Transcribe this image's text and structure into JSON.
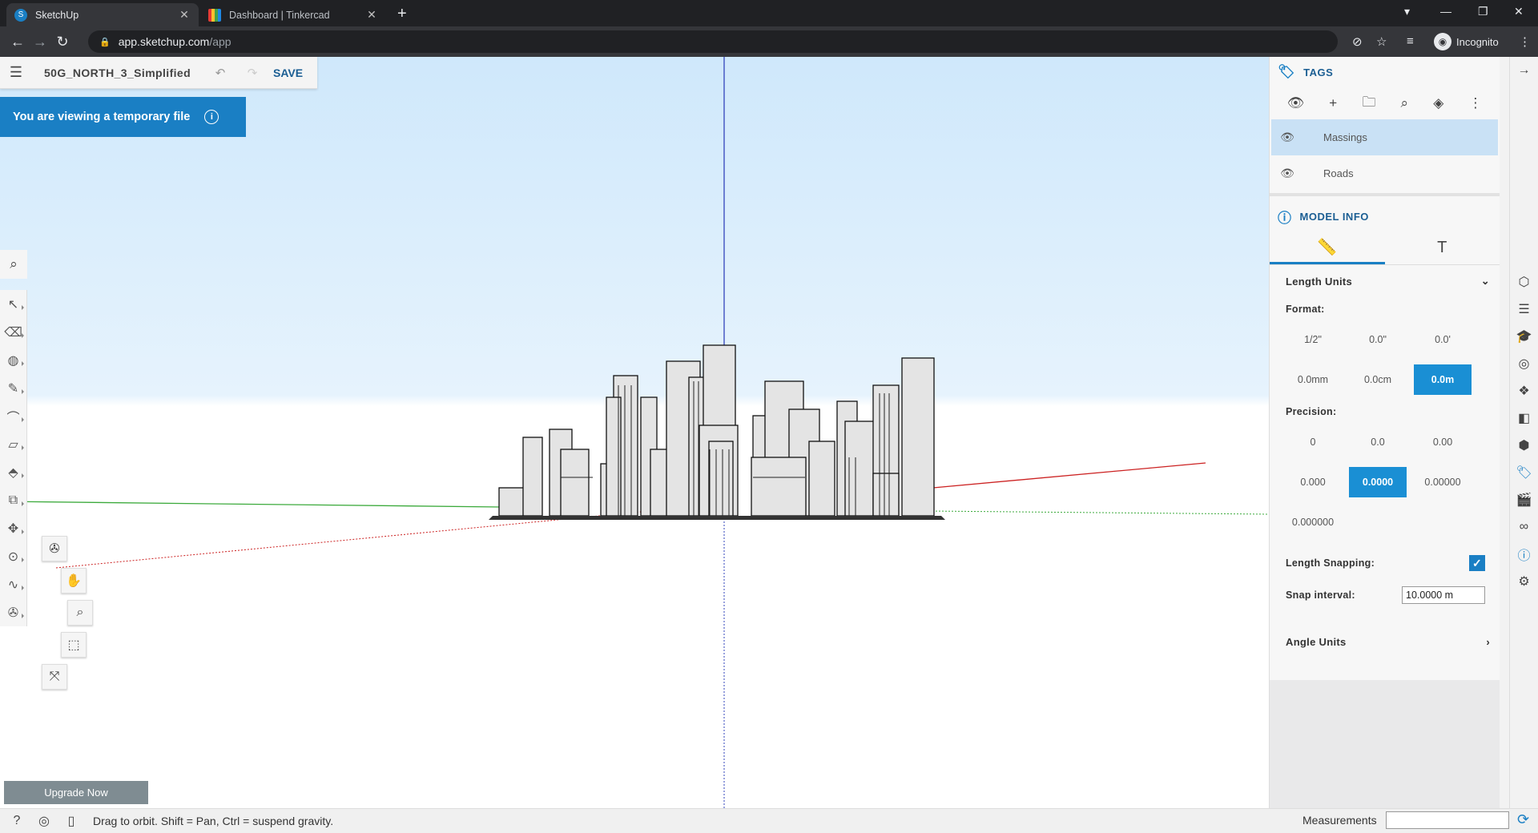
{
  "browser": {
    "tabs": [
      {
        "title": "SketchUp",
        "active": true,
        "icon": "sketchup-favicon"
      },
      {
        "title": "Dashboard | Tinkercad",
        "active": false,
        "icon": "tinkercad-favicon"
      }
    ],
    "url_host": "app.sketchup.com",
    "url_path": "/app",
    "profile_label": "Incognito"
  },
  "app": {
    "file_name": "50G_NORTH_3_Simplified",
    "save_label": "SAVE",
    "temp_banner": "You are viewing a temporary file",
    "upgrade_label": "Upgrade Now",
    "status_text": "Drag to orbit. Shift = Pan, Ctrl = suspend gravity.",
    "measurements_label": "Measurements",
    "measurements_value": ""
  },
  "tags_panel": {
    "title": "TAGS",
    "tags": [
      {
        "name": "Massings",
        "visible": true,
        "selected": true
      },
      {
        "name": "Roads",
        "visible": true,
        "selected": false
      }
    ]
  },
  "model_info": {
    "title": "MODEL INFO",
    "length_units_label": "Length Units",
    "format_label": "Format:",
    "format_options": [
      "1/2\"",
      "0.0\"",
      "0.0'",
      "0.0mm",
      "0.0cm",
      "0.0m"
    ],
    "format_selected": "0.0m",
    "precision_label": "Precision:",
    "precision_options": [
      "0",
      "0.0",
      "0.00",
      "0.000",
      "0.0000",
      "0.00000",
      "0.000000"
    ],
    "precision_selected": "0.0000",
    "length_snapping_label": "Length Snapping:",
    "length_snapping_checked": true,
    "snap_interval_label": "Snap interval:",
    "snap_interval_value": "10.0000 m",
    "angle_units_label": "Angle Units"
  },
  "colors": {
    "accent": "#1a7fc4",
    "selected_tag": "#c9e1f5",
    "sky": "#cfe8fb"
  }
}
